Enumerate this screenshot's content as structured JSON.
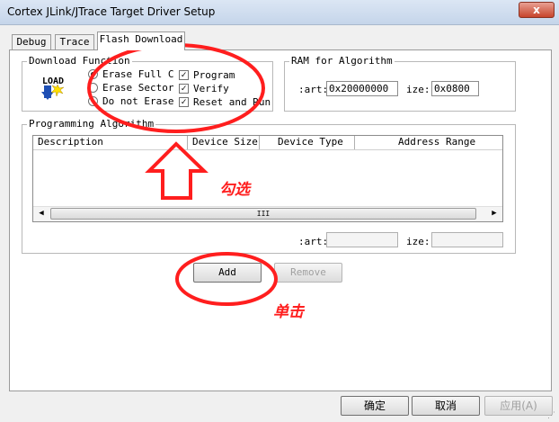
{
  "window": {
    "title": "Cortex JLink/JTrace Target Driver Setup",
    "close_glyph": "x"
  },
  "tabs": [
    {
      "label": "Debug",
      "active": false
    },
    {
      "label": "Trace",
      "active": false
    },
    {
      "label": "Flash Download",
      "active": true
    }
  ],
  "download_function": {
    "legend": "Download Function",
    "load_icon_text": "LOAD",
    "options": [
      {
        "label": "Erase Full C",
        "selected": true
      },
      {
        "label": "Erase Sector",
        "selected": false
      },
      {
        "label": "Do not Erase",
        "selected": false
      }
    ],
    "checks": [
      {
        "label": "Program",
        "checked": true
      },
      {
        "label": "Verify",
        "checked": true
      },
      {
        "label": "Reset and Run",
        "checked": true
      }
    ]
  },
  "ram_for_algorithm": {
    "legend": "RAM for Algorithm",
    "start_label": ":art:",
    "start_value": "0x20000000",
    "size_label": "ize:",
    "size_value": "0x0800"
  },
  "programming_algorithm": {
    "legend": "Programming Algorithm",
    "columns": [
      "Description",
      "Device Size",
      "Device Type",
      "Address Range"
    ],
    "scroll_thumb_glyph": "III",
    "start_label": ":art:",
    "start_value": "",
    "size_label": "ize:",
    "size_value": ""
  },
  "buttons": {
    "add": "Add",
    "remove": "Remove",
    "ok": "确定",
    "cancel": "取消",
    "apply": "应用(A)"
  },
  "annotations": {
    "check_note": "勾选",
    "click_note": "单击",
    "color": "#ff1e1e"
  }
}
